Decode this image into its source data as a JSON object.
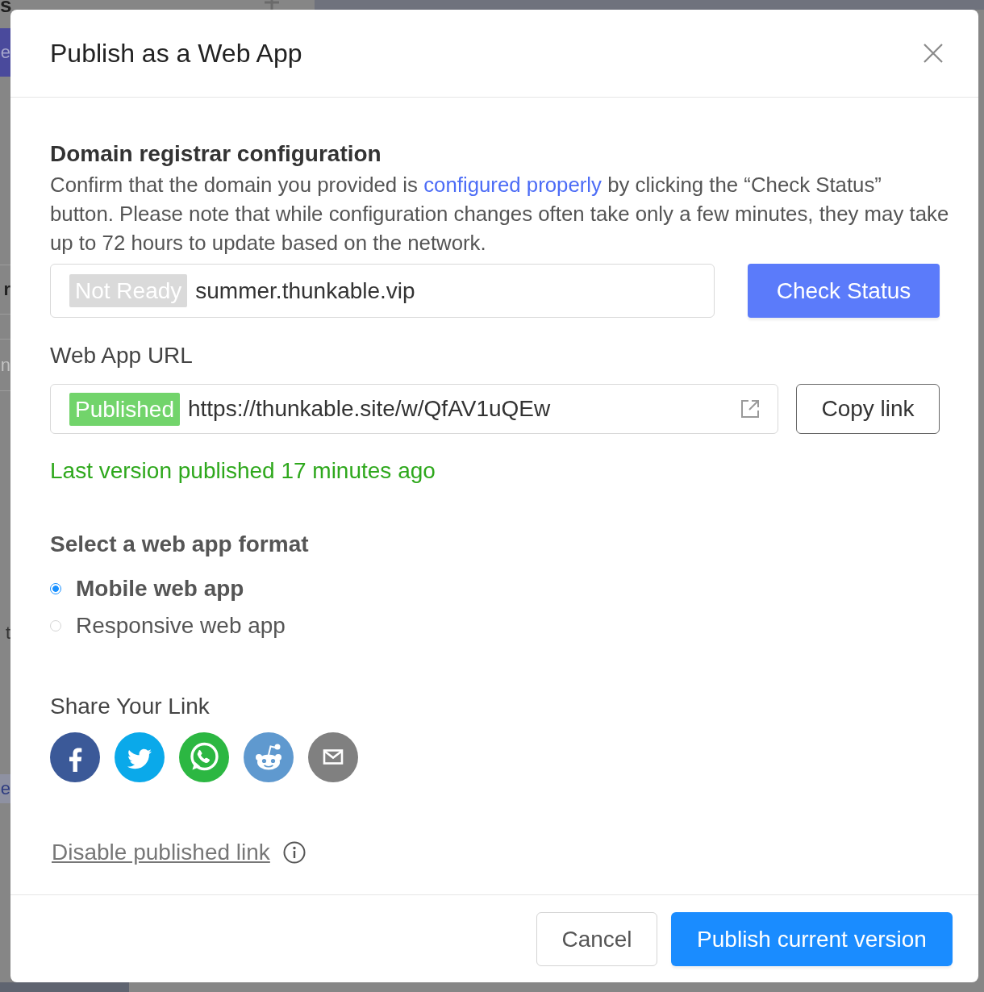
{
  "backdrop": {
    "fragments": [
      {
        "kind": "title",
        "text": "s"
      },
      {
        "kind": "button",
        "text": "e"
      },
      {
        "kind": "heading",
        "text": "r"
      },
      {
        "kind": "field",
        "text": "n"
      },
      {
        "kind": "label",
        "text": "t"
      },
      {
        "kind": "highlight",
        "text": "e"
      }
    ]
  },
  "dialog": {
    "title": "Publish as a Web App"
  },
  "domain": {
    "heading": "Domain registrar configuration",
    "description": [
      {
        "kind": "text",
        "text": "Confirm that the domain you provided is "
      },
      {
        "kind": "link",
        "text": "configured properly"
      },
      {
        "kind": "text",
        "text": " by clicking the “Check Status” button. Please note that while configuration changes often take only a few minutes, they may take up to 72 hours to update based on the network."
      }
    ],
    "status": {
      "label": "Not Ready",
      "active": false
    },
    "value": "summer.thunkable.vip",
    "button": "Check Status"
  },
  "web_app_url": {
    "label": "Web App URL",
    "status": {
      "label": "Published",
      "active": true
    },
    "value": "https://thunkable.site/w/QfAV1uQEw",
    "button": "Copy link",
    "note": "Last version published 17 minutes ago"
  },
  "format": {
    "heading": "Select a web app format",
    "options": [
      {
        "label": "Mobile web app",
        "selected": true
      },
      {
        "label": "Responsive web app",
        "selected": false
      }
    ]
  },
  "share": {
    "heading": "Share Your Link",
    "buttons": [
      {
        "kind": "facebook"
      },
      {
        "kind": "twitter"
      },
      {
        "kind": "whatsapp"
      },
      {
        "kind": "reddit"
      },
      {
        "kind": "email"
      }
    ]
  },
  "disable_link": "Disable published link",
  "footer": {
    "buttons": [
      {
        "label": "Cancel",
        "kind": "secondary"
      },
      {
        "label": "Publish current version",
        "kind": "primary"
      }
    ]
  }
}
